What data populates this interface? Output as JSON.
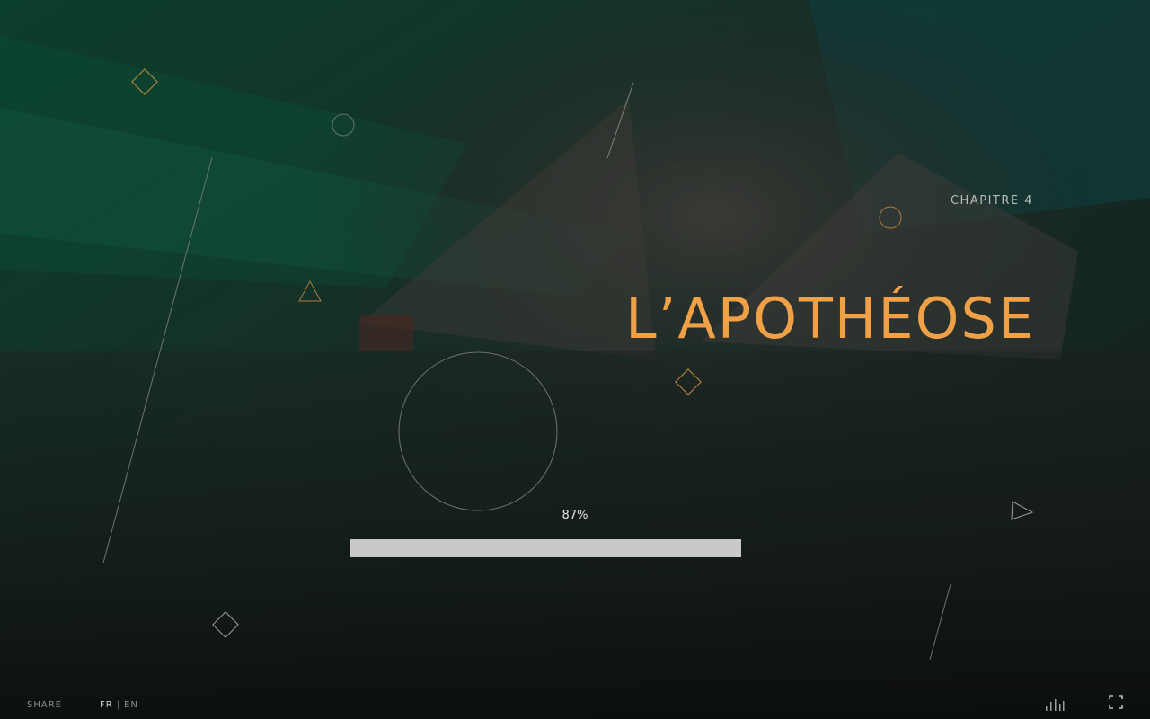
{
  "chapter": {
    "label": "CHAPITRE 4"
  },
  "title": {
    "text": "L’APOTHÉOSE"
  },
  "loading": {
    "percent_label": "87%",
    "progress": 0.87
  },
  "footer": {
    "share_label": "SHARE",
    "languages": {
      "active": "FR",
      "separator": "|",
      "other": "EN"
    }
  },
  "icons": {
    "audio": "audio-equalizer-icon",
    "fullscreen": "fullscreen-icon"
  },
  "colors": {
    "accent": "#f0a046",
    "bar": "#c9c9c9"
  }
}
